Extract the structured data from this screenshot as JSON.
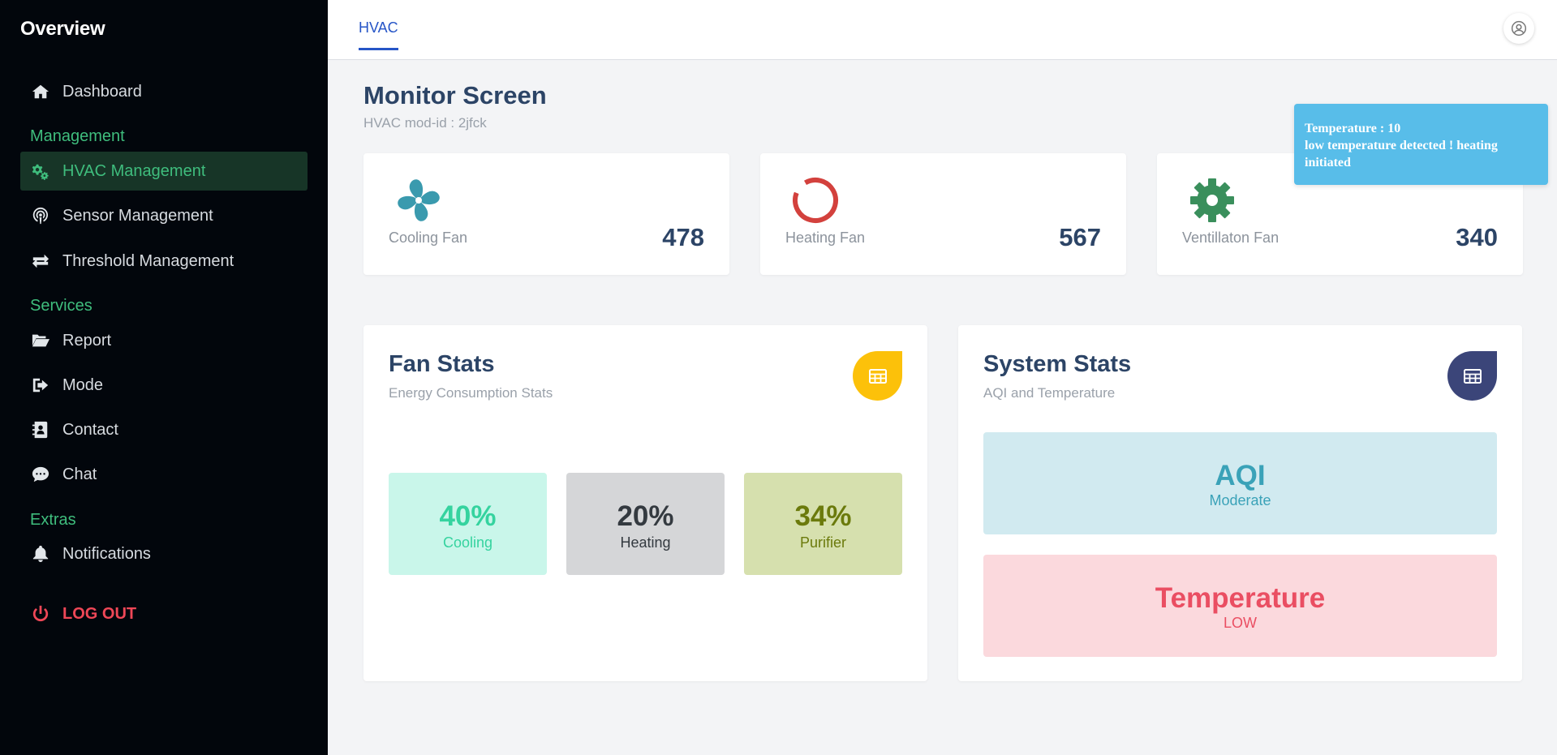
{
  "sidebar": {
    "title": "Overview",
    "dashboard": "Dashboard",
    "management_heading": "Management",
    "hvac_management": "HVAC Management",
    "sensor_management": "Sensor Management",
    "threshold_management": "Threshold Management",
    "services_heading": "Services",
    "report": "Report",
    "mode": "Mode",
    "contact": "Contact",
    "chat": "Chat",
    "extras_heading": "Extras",
    "notifications": "Notifications",
    "logout": "LOG OUT"
  },
  "topbar": {
    "tab": "HVAC"
  },
  "header": {
    "title": "Monitor Screen",
    "subtitle": "HVAC mod-id : 2jfck"
  },
  "toast": {
    "line1": "Temperature : 10",
    "line2": "low temperature detected ! heating initiated"
  },
  "fans": [
    {
      "label": "Cooling Fan",
      "value": "478",
      "icon": "fan-icon",
      "color": "#3a9aae"
    },
    {
      "label": "Heating Fan",
      "value": "567",
      "icon": "ring-icon",
      "color": "#d3413d"
    },
    {
      "label": "Ventillaton Fan",
      "value": "340",
      "icon": "gear-icon",
      "color": "#3a8f5c"
    }
  ],
  "fan_stats": {
    "title": "Fan Stats",
    "subtitle": "Energy Consumption Stats",
    "button_color": "#fcc10a",
    "items": [
      {
        "pct": "40%",
        "label": "Cooling",
        "bg": "#c9f6ea",
        "fg": "#35d39f"
      },
      {
        "pct": "20%",
        "label": "Heating",
        "bg": "#d5d6d8",
        "fg": "#343a40"
      },
      {
        "pct": "34%",
        "label": "Purifier",
        "bg": "#d6e0ae",
        "fg": "#6b7a0c"
      }
    ]
  },
  "system_stats": {
    "title": "System Stats",
    "subtitle": "AQI and Temperature",
    "button_color": "#3b4579",
    "aqi": {
      "title": "AQI",
      "status": "Moderate",
      "bg": "#d1eaf0",
      "fg": "#3aa2b8"
    },
    "temperature": {
      "title": "Temperature",
      "status": "LOW",
      "bg": "#fbd9dd",
      "fg": "#ea4e62"
    }
  }
}
